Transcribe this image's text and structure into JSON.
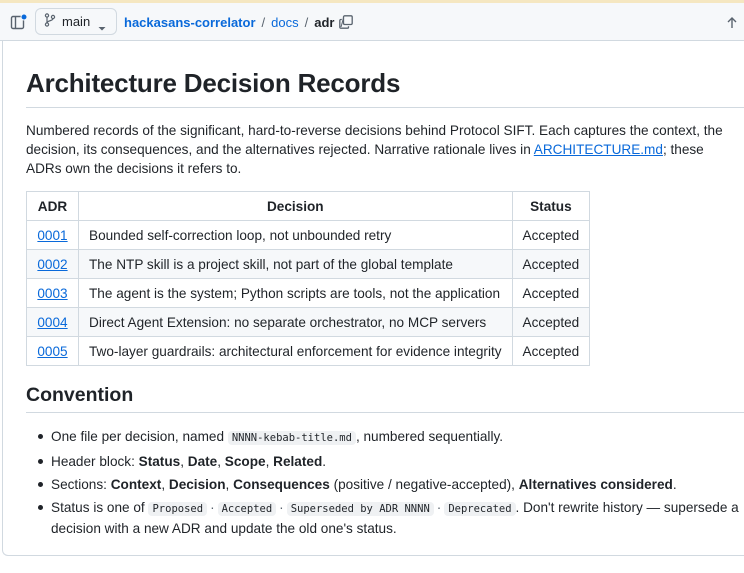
{
  "toolbar": {
    "branch": "main",
    "breadcrumb": {
      "repo": "hackasans-correlator",
      "dir": "docs",
      "current": "adr",
      "sep": "/"
    }
  },
  "doc": {
    "title": "Architecture Decision Records",
    "intro_before_link": "Numbered records of the significant, hard-to-reverse decisions behind Protocol SIFT. Each captures the context, the decision, its consequences, and the alternatives rejected. Narrative rationale lives in ",
    "intro_link": "ARCHITECTURE.md",
    "intro_after_link": "; these ADRs own the decisions it refers to.",
    "table": {
      "headers": {
        "adr": "ADR",
        "decision": "Decision",
        "status": "Status"
      },
      "rows": [
        {
          "adr": "0001",
          "decision": "Bounded self-correction loop, not unbounded retry",
          "status": "Accepted"
        },
        {
          "adr": "0002",
          "decision": "The NTP skill is a project skill, not part of the global template",
          "status": "Accepted"
        },
        {
          "adr": "0003",
          "decision": "The agent is the system; Python scripts are tools, not the application",
          "status": "Accepted"
        },
        {
          "adr": "0004",
          "decision": "Direct Agent Extension: no separate orchestrator, no MCP servers",
          "status": "Accepted"
        },
        {
          "adr": "0005",
          "decision": "Two-layer guardrails: architectural enforcement for evidence integrity",
          "status": "Accepted"
        }
      ]
    },
    "convention": {
      "heading": "Convention",
      "item1": {
        "a": "One file per decision, named ",
        "code": "NNNN-kebab-title.md",
        "b": ", numbered sequentially."
      },
      "item2": {
        "a": "Header block: ",
        "b1": "Status",
        "c1": ", ",
        "b2": "Date",
        "c2": ", ",
        "b3": "Scope",
        "c3": ", ",
        "b4": "Related",
        "end": "."
      },
      "item3": {
        "a": "Sections: ",
        "b1": "Context",
        "c1": ", ",
        "b2": "Decision",
        "c2": ", ",
        "b3": "Consequences",
        "c3": " (positive / negative-accepted), ",
        "b4": "Alternatives considered",
        "end": "."
      },
      "item4": {
        "a": "Status is one of ",
        "codes": [
          "Proposed",
          "Accepted",
          "Superseded by ADR NNNN",
          "Deprecated"
        ],
        "dot": "·",
        "b": ". Don't rewrite history — supersede a decision with a new ADR and update the old one's status."
      }
    }
  },
  "colors": {
    "link": "#0969da",
    "border": "#d1d9e0",
    "text": "#1f2328",
    "toolbar_bg": "#f6f8fa"
  },
  "icons": [
    "sidebar-toggle-icon",
    "git-branch-icon",
    "chevron-down-icon",
    "copy-icon",
    "arrow-up-icon"
  ]
}
